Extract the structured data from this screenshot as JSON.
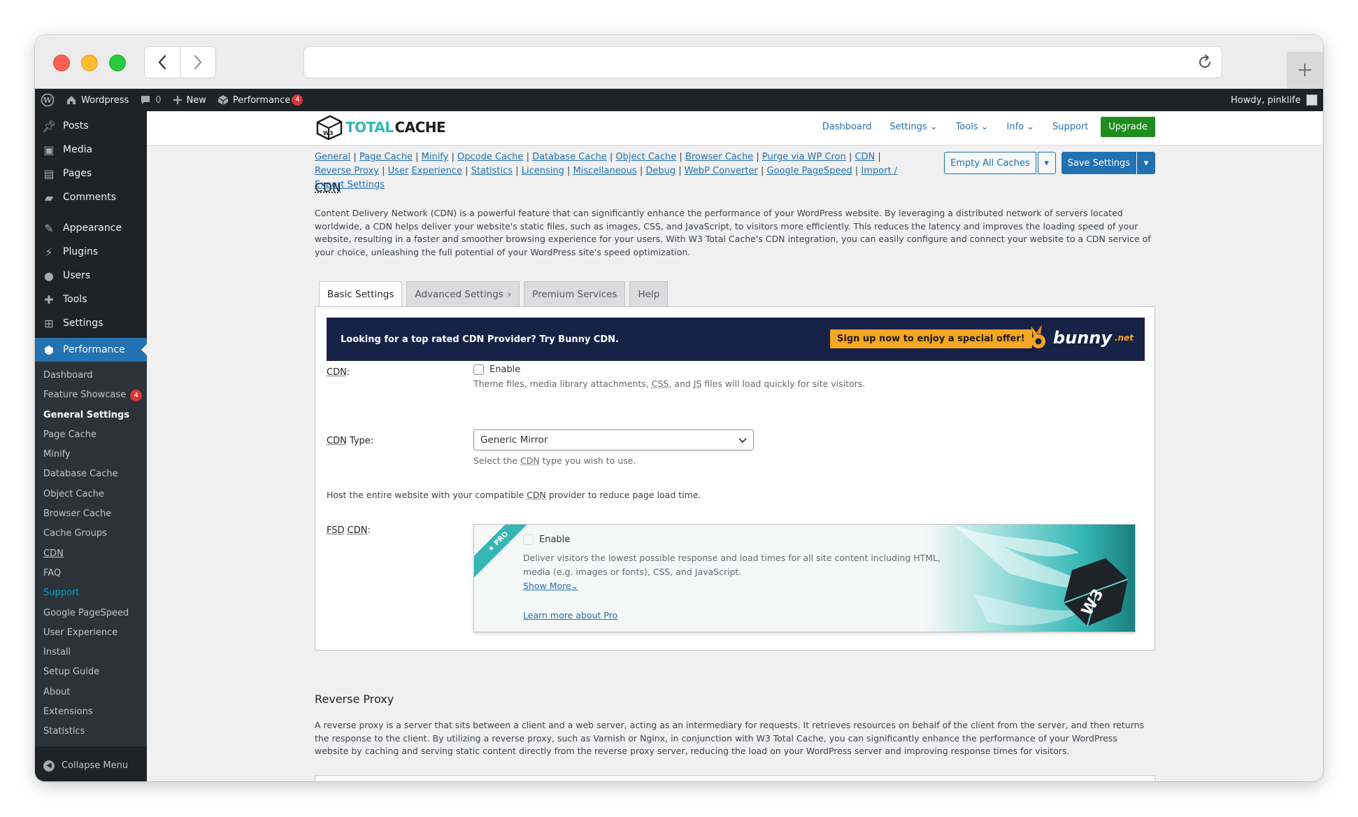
{
  "adminbar": {
    "site_name": "Wordpress",
    "comments_count": "0",
    "new_label": "New",
    "performance_label": "Performance",
    "performance_count": "4",
    "howdy": "Howdy, pinklife"
  },
  "sidebar": {
    "items": [
      {
        "label": "Posts",
        "icon": "pin-icon"
      },
      {
        "label": "Media",
        "icon": "media-icon"
      },
      {
        "label": "Pages",
        "icon": "pages-icon"
      },
      {
        "label": "Comments",
        "icon": "comment-icon"
      },
      {
        "label": "Appearance",
        "icon": "brush-icon"
      },
      {
        "label": "Plugins",
        "icon": "plugin-icon"
      },
      {
        "label": "Users",
        "icon": "user-icon"
      },
      {
        "label": "Tools",
        "icon": "wrench-icon"
      },
      {
        "label": "Settings",
        "icon": "settings-icon"
      }
    ],
    "active": "Performance",
    "submenu": {
      "dashboard": "Dashboard",
      "feature_showcase": "Feature Showcase",
      "feature_badge": "4",
      "general_settings": "General Settings",
      "page_cache": "Page Cache",
      "minify": "Minify",
      "database_cache": "Database Cache",
      "object_cache": "Object Cache",
      "browser_cache": "Browser Cache",
      "cache_groups": "Cache Groups",
      "cdn": "CDN",
      "faq": "FAQ",
      "support": "Support",
      "google_pagespeed": "Google PageSpeed",
      "user_experience": "User Experience",
      "install": "Install",
      "setup_guide": "Setup Guide",
      "about": "About",
      "extensions": "Extensions",
      "statistics": "Statistics"
    },
    "collapse": "Collapse Menu"
  },
  "header": {
    "logo_w3": "W3",
    "logo_total": "TOTAL",
    "logo_cache": "CACHE",
    "nav": {
      "dashboard": "Dashboard",
      "settings": "Settings",
      "tools": "Tools",
      "info": "Info",
      "support": "Support",
      "upgrade": "Upgrade"
    }
  },
  "sublinks": {
    "general": "General",
    "page_cache": "Page Cache",
    "minify": "Minify",
    "opcode_cache": "Opcode Cache",
    "database_cache": "Database Cache",
    "object_cache": "Object Cache",
    "browser_cache": "Browser Cache",
    "purge_via_wp_cron": "Purge via WP Cron",
    "cdn": "CDN",
    "reverse_proxy": "Reverse Proxy",
    "user": "User",
    "experience": "Experience",
    "statistics": "Statistics",
    "licensing": "Licensing",
    "miscellaneous": "Miscellaneous",
    "debug": "Debug",
    "webp_converter": "WebP Converter",
    "google_pagespeed": "Google PageSpeed",
    "import_export": "Import / Export Settings",
    "sep": "|"
  },
  "actions": {
    "empty_all_caches": "Empty All Caches",
    "save_settings": "Save Settings"
  },
  "page": {
    "title": "CDN",
    "intro": "Content Delivery Network (CDN) is a powerful feature that can significantly enhance the performance of your WordPress website. By leveraging a distributed network of servers located worldwide, a CDN helps deliver your website's static files, such as images, CSS, and JavaScript, to visitors more efficiently. This reduces the latency and improves the loading speed of your website, resulting in a faster and smoother browsing experience for your users. With W3 Total Cache's CDN integration, you can easily configure and connect your website to a CDN service of your choice, unleashing the full potential of your WordPress site's speed optimization."
  },
  "tabs": {
    "basic": "Basic Settings",
    "advanced": "Advanced Settings",
    "premium": "Premium Services",
    "help": "Help"
  },
  "bunny": {
    "text": "Looking for a top rated CDN Provider? Try Bunny CDN.",
    "cta": "Sign up now to enjoy a special offer!",
    "logo": "bunny",
    "logo_suffix": ".net"
  },
  "cdn_row": {
    "label": "CDN",
    "colon": ":",
    "enable": "Enable",
    "desc_a": "Theme files, media library attachments, ",
    "desc_css": "CSS",
    "desc_b": ", and ",
    "desc_js": "JS",
    "desc_c": " files will load quickly for site visitors."
  },
  "cdn_type": {
    "label_abbr": "CDN",
    "label_rest": " Type:",
    "value": "Generic Mirror",
    "desc_a": "Select the ",
    "desc_abbr": "CDN",
    "desc_b": " type you wish to use."
  },
  "host": {
    "text_a": "Host the entire website with your compatible ",
    "abbr": "CDN",
    "text_b": " provider to reduce page load time."
  },
  "fsd": {
    "label_a": "FSD",
    "label_b": "CDN",
    "colon": ":",
    "ribbon": "★ PRO",
    "enable": "Enable",
    "desc": "Deliver visitors the lowest possible response and load times for all site content including HTML, media (e.g. images or fonts), CSS, and JavaScript.",
    "show_more": "Show More",
    "learn_more": "Learn more about Pro"
  },
  "reverse_proxy": {
    "title": "Reverse Proxy",
    "desc": "A reverse proxy is a server that sits between a client and a web server, acting as an intermediary for requests. It retrieves resources on behalf of the client from the server, and then returns the response to the client. By utilizing a reverse proxy, such as Varnish or Nginx, in conjunction with W3 Total Cache, you can significantly enhance the performance of your WordPress website by caching and serving static content directly from the reverse proxy server, reducing the load on your WordPress server and improving response times for visitors."
  },
  "colors": {
    "admin_dark": "#1d2327",
    "wp_blue": "#2271b1",
    "w3_teal": "#35b7b5",
    "upgrade_green": "#1e8c1e",
    "bunny_navy": "#172247",
    "bunny_orange": "#f5a623"
  }
}
